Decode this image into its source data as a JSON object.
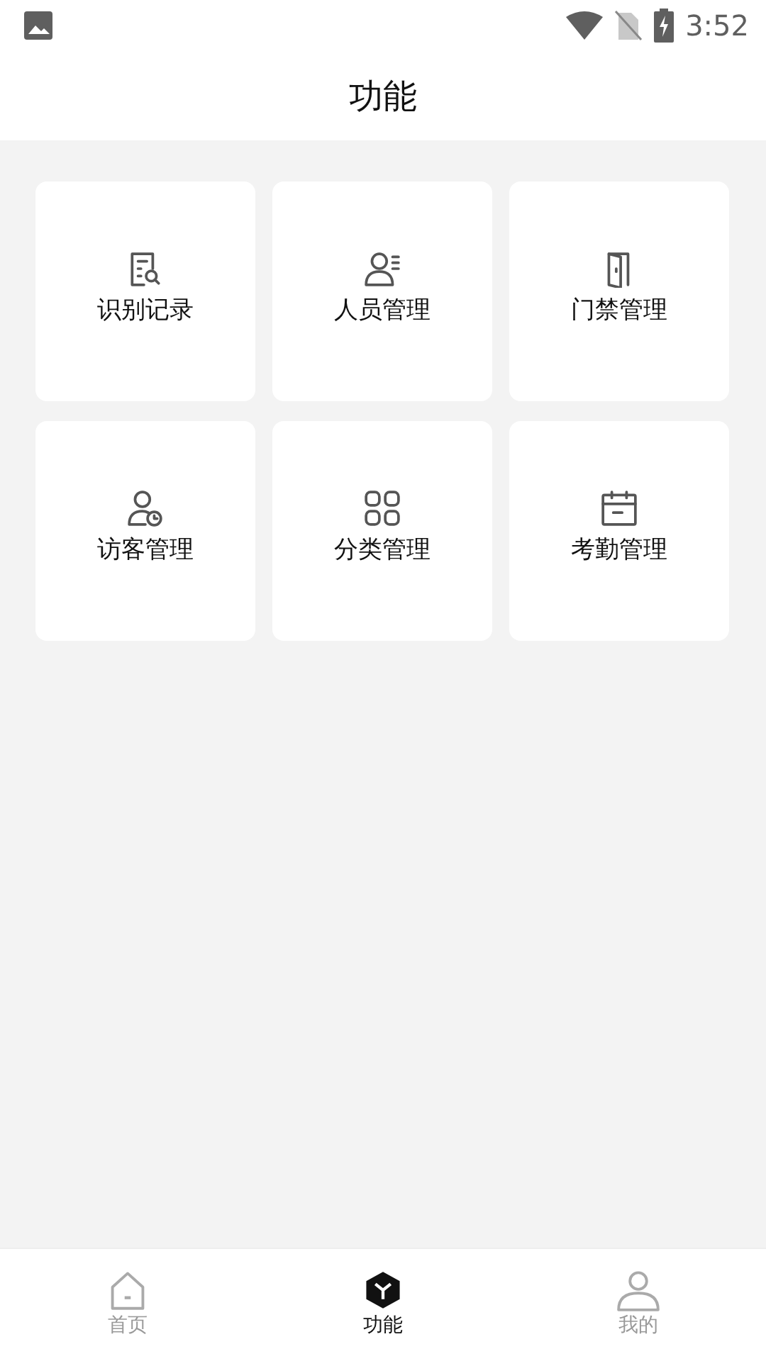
{
  "status_bar": {
    "time": "3:52"
  },
  "header": {
    "title": "功能"
  },
  "tiles": [
    {
      "kind": "record",
      "label": "识别记录"
    },
    {
      "kind": "person",
      "label": "人员管理"
    },
    {
      "kind": "door",
      "label": "门禁管理"
    },
    {
      "kind": "visitor",
      "label": "访客管理"
    },
    {
      "kind": "grid",
      "label": "分类管理"
    },
    {
      "kind": "calendar",
      "label": "考勤管理"
    }
  ],
  "tab_bar": [
    {
      "kind": "home",
      "label": "首页",
      "selected": false
    },
    {
      "kind": "cube",
      "label": "功能",
      "selected": true
    },
    {
      "kind": "user",
      "label": "我的",
      "selected": false
    }
  ]
}
